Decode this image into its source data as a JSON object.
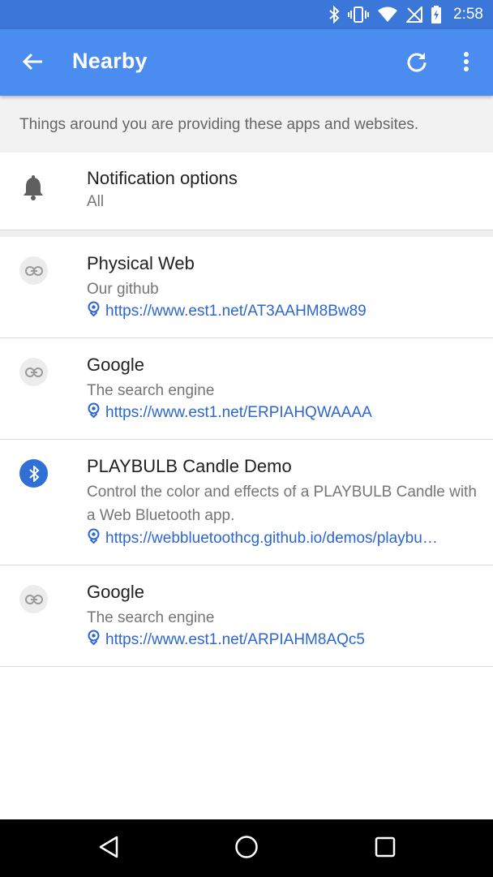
{
  "status_bar": {
    "time": "2:58",
    "icons": [
      "bluetooth-icon",
      "vibrate-icon",
      "wifi-icon",
      "no-signal-icon",
      "battery-charging-icon"
    ]
  },
  "app_bar": {
    "title": "Nearby",
    "back_icon": "arrow-back-icon",
    "refresh_icon": "refresh-icon",
    "more_icon": "more-vert-icon",
    "color": "#4a8cf0"
  },
  "intro": {
    "text": "Things around you are providing these apps and websites."
  },
  "notification_options": {
    "title": "Notification options",
    "value": "All",
    "icon": "bell-icon"
  },
  "items": [
    {
      "title": "Physical Web",
      "description": "Our github",
      "url": "https://www.est1.net/AT3AAHM8Bw89",
      "icon": "link-icon"
    },
    {
      "title": "Google",
      "description": "The search engine",
      "url": "https://www.est1.net/ERPIAHQWAAAA",
      "icon": "link-icon"
    },
    {
      "title": "PLAYBULB Candle Demo",
      "description": "Control the color and effects of a PLAYBULB Candle with a Web Bluetooth app.",
      "url": "https://webbluetoothcg.github.io/demos/playbu…",
      "icon": "bluetooth-icon"
    },
    {
      "title": "Google",
      "description": "The search engine",
      "url": "https://www.est1.net/ARPIAHM8AQc5",
      "icon": "link-icon"
    }
  ],
  "nav_bar": {
    "icons": [
      "back-triangle-icon",
      "home-circle-icon",
      "recents-square-icon"
    ]
  },
  "colors": {
    "link": "#2c66cf",
    "status_bar": "#3b77d8",
    "bluetooth_badge": "#2f6fd6"
  }
}
